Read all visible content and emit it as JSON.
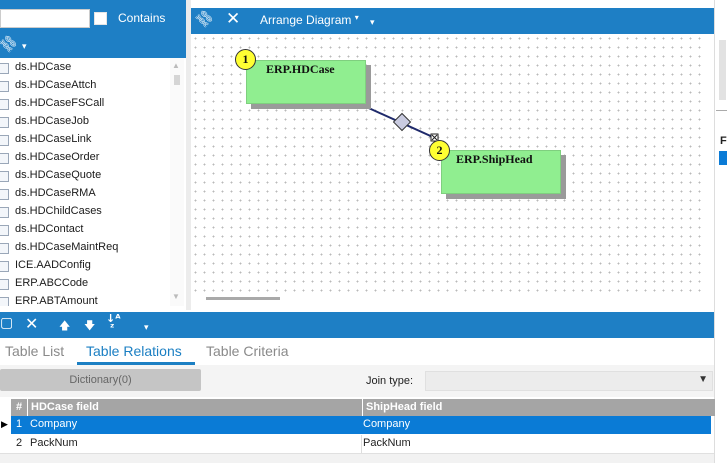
{
  "top_left": {
    "search_value": "",
    "contains_label": "Contains",
    "contains_checked": false
  },
  "table_list": {
    "items": [
      "ds.HDCase",
      "ds.HDCaseAttch",
      "ds.HDCaseFSCall",
      "ds.HDCaseJob",
      "ds.HDCaseLink",
      "ds.HDCaseOrder",
      "ds.HDCaseQuote",
      "ds.HDCaseRMA",
      "ds.HDChildCases",
      "ds.HDContact",
      "ds.HDCaseMaintReq",
      "ICE.AADConfig",
      "ERP.ABCCode",
      "ERP.ABTAmount"
    ]
  },
  "diagram_toolbar": {
    "arrange_label": "Arrange Diagram"
  },
  "diagram": {
    "nodes": [
      {
        "badge": "1",
        "title": "ERP.HDCase"
      },
      {
        "badge": "2",
        "title": "ERP.ShipHead"
      }
    ]
  },
  "tabs": [
    {
      "label": "Table List",
      "active": false
    },
    {
      "label": "Table Relations",
      "active": true
    },
    {
      "label": "Table Criteria",
      "active": false
    }
  ],
  "relations": {
    "dictionary_label": "Dictionary(0)",
    "join_type_label": "Join type:",
    "join_type_value": ""
  },
  "grid": {
    "headers": [
      "#",
      "HDCase field",
      "ShipHead field"
    ],
    "rows": [
      {
        "num": "1",
        "left": "Company",
        "right": "Company",
        "selected": true
      },
      {
        "num": "2",
        "left": "PackNum",
        "right": "PackNum",
        "selected": false
      }
    ]
  },
  "right_panel": {
    "letters": [
      "F"
    ]
  },
  "colors": {
    "accent": "#1e7fc5",
    "node_fill": "#90ee90",
    "badge": "#ffff33",
    "selected_row": "#0a7bd6"
  }
}
